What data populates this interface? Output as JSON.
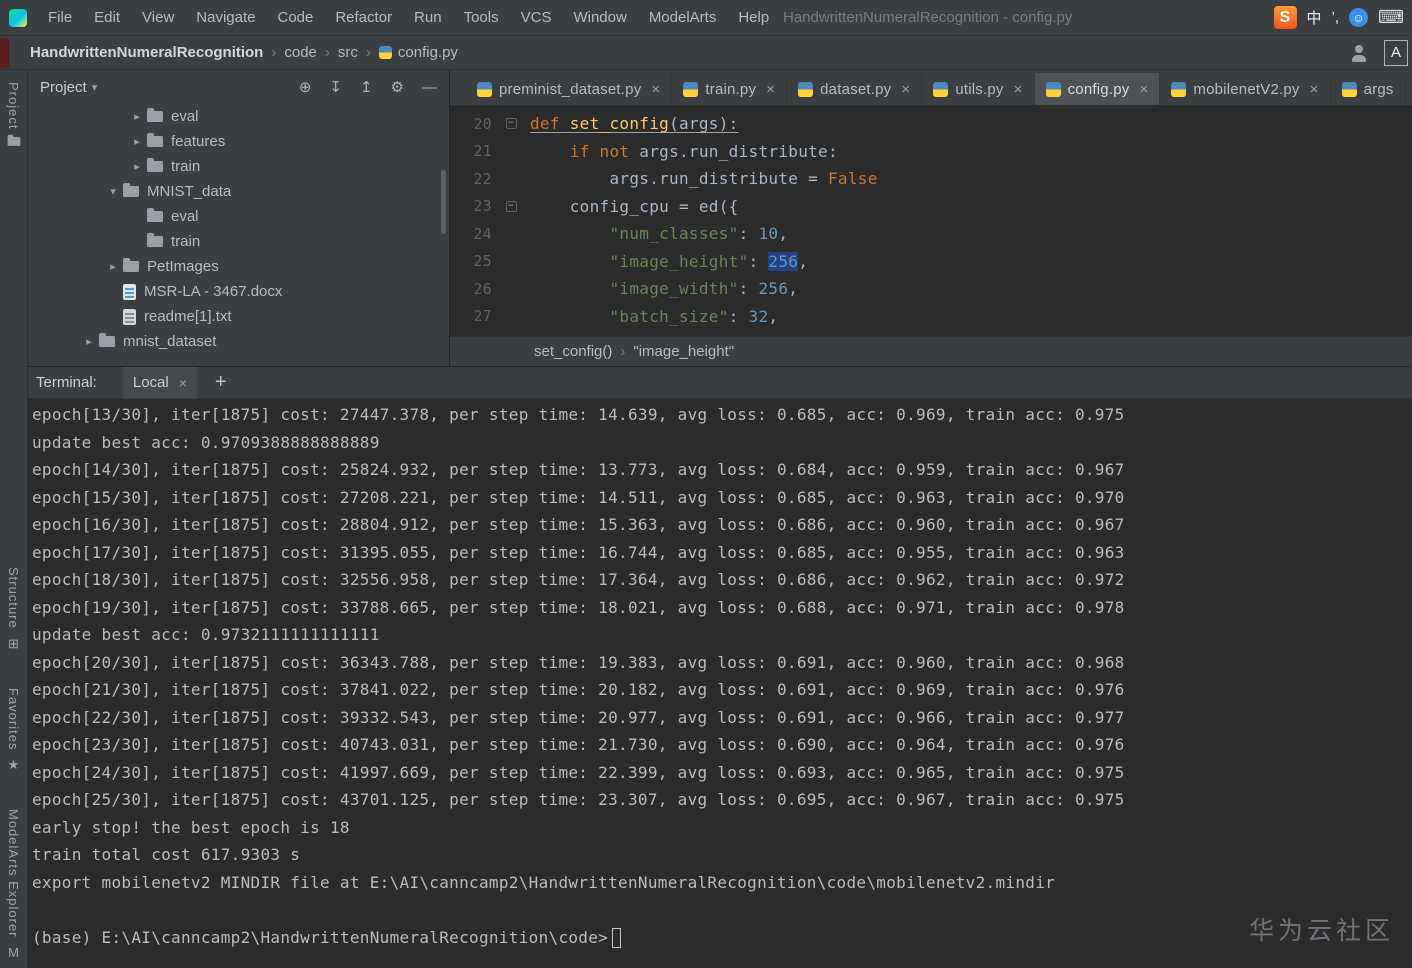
{
  "menu_bar": {
    "items": [
      "File",
      "Edit",
      "View",
      "Navigate",
      "Code",
      "Refactor",
      "Run",
      "Tools",
      "VCS",
      "Window",
      "ModelArts",
      "Help"
    ],
    "window_title": "HandwrittenNumeralRecognition - config.py",
    "tray": [
      {
        "name": "sogou-ime",
        "glyph": "S",
        "style": "sogou"
      },
      {
        "name": "ime-language",
        "glyph": "中",
        "style": "lang"
      },
      {
        "name": "ime-punctuation",
        "glyph": "’,",
        "style": "lang"
      },
      {
        "name": "ime-status",
        "glyph": "☺",
        "style": "face"
      },
      {
        "name": "soft-keyboard",
        "glyph": "⌨",
        "style": "kbd"
      }
    ]
  },
  "breadcrumb_bar": {
    "items": [
      "HandwrittenNumeralRecognition",
      "code",
      "src",
      "config.py"
    ],
    "separator": "›",
    "badge": "A"
  },
  "tool_stripe": {
    "top": [
      {
        "label": "Project",
        "icon": "folder"
      }
    ],
    "bottom": [
      {
        "label": "Structure",
        "icon": "structure",
        "glyph": "⊞"
      },
      {
        "label": "Favorites",
        "icon": "favorites-star",
        "glyph": "★"
      },
      {
        "label": "ModelArts Explorer",
        "icon": "modelarts",
        "glyph": "M"
      }
    ]
  },
  "project_panel": {
    "title": "Project",
    "caret": "▾",
    "toolbar_icons": [
      {
        "name": "select-opened-file",
        "glyph": "⊕"
      },
      {
        "name": "expand-all",
        "glyph": "↧"
      },
      {
        "name": "collapse-all",
        "glyph": "↥"
      },
      {
        "name": "settings",
        "glyph": "⚙"
      },
      {
        "name": "hide-panel",
        "glyph": "—"
      }
    ],
    "tree": [
      {
        "label": "eval",
        "indent": 3,
        "chevron": ">",
        "icon": "folder"
      },
      {
        "label": "features",
        "indent": 3,
        "chevron": ">",
        "icon": "folder"
      },
      {
        "label": "train",
        "indent": 3,
        "chevron": ">",
        "icon": "folder"
      },
      {
        "label": "MNIST_data",
        "indent": 2,
        "chevron": "v",
        "icon": "folder"
      },
      {
        "label": "eval",
        "indent": 3,
        "chevron": "",
        "icon": "folder"
      },
      {
        "label": "train",
        "indent": 3,
        "chevron": "",
        "icon": "folder"
      },
      {
        "label": "PetImages",
        "indent": 2,
        "chevron": ">",
        "icon": "folder"
      },
      {
        "label": "MSR-LA - 3467.docx",
        "indent": 2,
        "chevron": "",
        "icon": "doc"
      },
      {
        "label": "readme[1].txt",
        "indent": 2,
        "chevron": "",
        "icon": "txt"
      },
      {
        "label": "mnist_dataset",
        "indent": 1,
        "chevron": ">",
        "icon": "folder"
      }
    ]
  },
  "editor": {
    "close_glyph": "×",
    "tabs": [
      {
        "label": "preminist_dataset.py"
      },
      {
        "label": "train.py"
      },
      {
        "label": "dataset.py"
      },
      {
        "label": "utils.py"
      },
      {
        "label": "config.py",
        "active": true
      },
      {
        "label": "mobilenetV2.py"
      },
      {
        "label": "args",
        "cut": true
      }
    ],
    "lines": [
      {
        "num": "20",
        "fold": true,
        "segments": [
          {
            "t": "def ",
            "c": "kw u"
          },
          {
            "t": "set_config",
            "c": "fn u"
          },
          {
            "t": "(args):",
            "c": "pl u"
          }
        ]
      },
      {
        "num": "21",
        "segments": [
          {
            "t": "    ",
            "c": "pl"
          },
          {
            "t": "if not ",
            "c": "kw"
          },
          {
            "t": "args.run_distribute:",
            "c": "pl"
          }
        ]
      },
      {
        "num": "22",
        "segments": [
          {
            "t": "        args.run_distribute = ",
            "c": "pl"
          },
          {
            "t": "False",
            "c": "kw"
          }
        ]
      },
      {
        "num": "23",
        "fold": true,
        "segments": [
          {
            "t": "    config_cpu = ed({",
            "c": "pl"
          }
        ]
      },
      {
        "num": "24",
        "segments": [
          {
            "t": "        ",
            "c": "pl"
          },
          {
            "t": "\"num_classes\"",
            "c": "str"
          },
          {
            "t": ": ",
            "c": "pl"
          },
          {
            "t": "10",
            "c": "num"
          },
          {
            "t": ",",
            "c": "pl"
          }
        ]
      },
      {
        "num": "25",
        "segments": [
          {
            "t": "        ",
            "c": "pl"
          },
          {
            "t": "\"image_height\"",
            "c": "str"
          },
          {
            "t": ": ",
            "c": "pl"
          },
          {
            "t": "256",
            "c": "num sel"
          },
          {
            "t": ",",
            "c": "pl"
          }
        ]
      },
      {
        "num": "26",
        "segments": [
          {
            "t": "        ",
            "c": "pl"
          },
          {
            "t": "\"image_width\"",
            "c": "str"
          },
          {
            "t": ": ",
            "c": "pl"
          },
          {
            "t": "256",
            "c": "num"
          },
          {
            "t": ",",
            "c": "pl"
          }
        ]
      },
      {
        "num": "27",
        "segments": [
          {
            "t": "        ",
            "c": "pl"
          },
          {
            "t": "\"batch_size\"",
            "c": "str"
          },
          {
            "t": ": ",
            "c": "pl"
          },
          {
            "t": "32",
            "c": "num"
          },
          {
            "t": ",",
            "c": "pl"
          }
        ]
      }
    ],
    "breadcrumb": [
      "set_config()",
      "\"image_height\""
    ]
  },
  "terminal": {
    "title": "Terminal:",
    "tab": "Local",
    "close_glyph": "×",
    "new_tab_glyph": "+",
    "lines": [
      "epoch[13/30], iter[1875] cost: 27447.378, per step time: 14.639, avg loss: 0.685, acc: 0.969, train acc: 0.975",
      "update best acc: 0.9709388888888889",
      "epoch[14/30], iter[1875] cost: 25824.932, per step time: 13.773, avg loss: 0.684, acc: 0.959, train acc: 0.967",
      "epoch[15/30], iter[1875] cost: 27208.221, per step time: 14.511, avg loss: 0.685, acc: 0.963, train acc: 0.970",
      "epoch[16/30], iter[1875] cost: 28804.912, per step time: 15.363, avg loss: 0.686, acc: 0.960, train acc: 0.967",
      "epoch[17/30], iter[1875] cost: 31395.055, per step time: 16.744, avg loss: 0.685, acc: 0.955, train acc: 0.963",
      "epoch[18/30], iter[1875] cost: 32556.958, per step time: 17.364, avg loss: 0.686, acc: 0.962, train acc: 0.972",
      "epoch[19/30], iter[1875] cost: 33788.665, per step time: 18.021, avg loss: 0.688, acc: 0.971, train acc: 0.978",
      "update best acc: 0.9732111111111111",
      "epoch[20/30], iter[1875] cost: 36343.788, per step time: 19.383, avg loss: 0.691, acc: 0.960, train acc: 0.968",
      "epoch[21/30], iter[1875] cost: 37841.022, per step time: 20.182, avg loss: 0.691, acc: 0.969, train acc: 0.976",
      "epoch[22/30], iter[1875] cost: 39332.543, per step time: 20.977, avg loss: 0.691, acc: 0.966, train acc: 0.977",
      "epoch[23/30], iter[1875] cost: 40743.031, per step time: 21.730, avg loss: 0.690, acc: 0.964, train acc: 0.976",
      "epoch[24/30], iter[1875] cost: 41997.669, per step time: 22.399, avg loss: 0.693, acc: 0.965, train acc: 0.975",
      "epoch[25/30], iter[1875] cost: 43701.125, per step time: 23.307, avg loss: 0.695, acc: 0.967, train acc: 0.975",
      "early stop! the best epoch is 18",
      "train total cost 617.9303 s",
      "export mobilenetv2 MINDIR file at E:\\AI\\canncamp2\\HandwrittenNumeralRecognition\\code\\mobilenetv2.mindir",
      ""
    ],
    "prompt": "(base) E:\\AI\\canncamp2\\HandwrittenNumeralRecognition\\code>"
  },
  "watermark": {
    "text": "华为云社区"
  },
  "colors": {
    "selection": "#214283",
    "keyword": "#cc7832",
    "string": "#6a8759",
    "number": "#6897bb",
    "function": "#ffc66d"
  }
}
